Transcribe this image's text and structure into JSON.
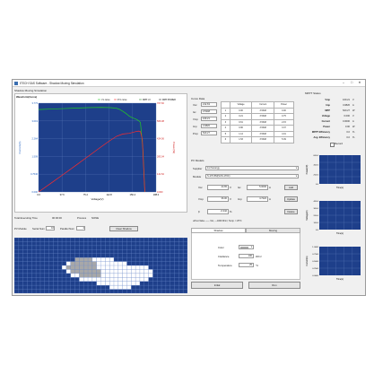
{
  "window": {
    "title": "ITECH SAS Software - Shadow Moving Simulation",
    "min": "–",
    "max": "□",
    "close": "✕"
  },
  "section_title": "Shadow Moving Simulation",
  "chart_data": {
    "type": "line",
    "title": "Waveform(Curve)",
    "xlabel": "Voltage(V)",
    "ylabel_left": "Current(A)",
    "ylabel_right": "Power(W)",
    "legend": [
      "I-V curve",
      "P-V curve",
      "MPP I-V",
      "MPP POWER"
    ],
    "legend_placement": "top-right",
    "grid": true,
    "xlim": [
      0,
      188
    ],
    "ylim_left": [
      0,
      3.77
    ],
    "ylim_right": [
      0,
      707.6
    ],
    "x_ticks": [
      "0.0",
      "37.6",
      "75.2",
      "112.8",
      "150.4",
      "188.0"
    ],
    "y_left_ticks": [
      "0.000",
      "0.7546",
      "1.509",
      "2.264",
      "3.019",
      "3.773"
    ],
    "y_right_ticks": [
      "0.000",
      "141.52",
      "283.04",
      "424.56",
      "566.08",
      "707.60"
    ],
    "series": [
      {
        "name": "I-V curve",
        "color": "#22cc22",
        "x": [
          0,
          20,
          40,
          60,
          80,
          100,
          115,
          125,
          130,
          135,
          140,
          145,
          150,
          155,
          160,
          163,
          167,
          170
        ],
        "y": [
          3.5,
          3.52,
          3.54,
          3.56,
          3.58,
          3.59,
          3.58,
          3.55,
          3.5,
          3.42,
          3.33,
          3.22,
          3.15,
          3.1,
          3.03,
          2.95,
          1.8,
          0
        ]
      },
      {
        "name": "P-V curve",
        "color": "#ff2a2a",
        "x": [
          0,
          20,
          40,
          60,
          80,
          100,
          115,
          125,
          135,
          145,
          155,
          160,
          163,
          166,
          170
        ],
        "y": [
          0,
          70,
          141,
          213,
          286,
          359,
          412,
          444,
          462,
          467,
          480,
          485,
          481,
          420,
          0
        ]
      }
    ]
  },
  "bottom_left": {
    "total_label": "Total Executing Time",
    "total_value": "00:00:00",
    "process_label": "Process",
    "process_value": "NONE",
    "pv_label": "PV Module",
    "serial_label": "Serial Num",
    "serial_value": "10",
    "parallel_label": "Parallel Num",
    "parallel_value": "4",
    "clear_btn": "Clear Shadow"
  },
  "curve_data": {
    "title": "Curve Data",
    "fields": [
      {
        "label": "Voc",
        "value": "212.63"
      },
      {
        "label": "Isc",
        "value": "3.5348"
      },
      {
        "label": "Vmp",
        "value": "169.21"
      },
      {
        "label": "Imp",
        "value": "3.0826"
      },
      {
        "label": "Pmp",
        "value": "520.27"
      }
    ],
    "columns": [
      "",
      "Voltage",
      "Current",
      "Power"
    ],
    "rows": [
      [
        "1",
        "0.00",
        "3.5348",
        "0.00"
      ],
      [
        "2",
        "0.21",
        "3.5348",
        "0.75"
      ],
      [
        "3",
        "0.61",
        "3.5348",
        "2.15"
      ],
      [
        "4",
        "0.96",
        "3.5348",
        "3.37"
      ],
      [
        "5",
        "1.14",
        "3.5348",
        "4.01"
      ],
      [
        "6",
        "1.53",
        "3.5348",
        "5.39"
      ]
    ]
  },
  "pv_models": {
    "title": "PV Models",
    "supplier_label": "Supplier",
    "supplier_value": "1st Sunergy",
    "module_label": "Module",
    "module_value": "S-170-5M(SUS-170C)",
    "voc_label": "Voc",
    "voc_value": "44.65",
    "voc_unit": "V",
    "isc_label": "Isc",
    "isc_value": "5.0000",
    "isc_unit": "A",
    "vmp_label": "Vmp",
    "vmp_value": "36.00",
    "vmp_unit": "V",
    "imp_label": "Imp",
    "imp_value": "4.7222",
    "imp_unit": "A",
    "ff_label": "β",
    "ff_value": "-0.342",
    "ff_unit": "%",
    "add_btn": "Add",
    "update_btn": "Update",
    "delete_btn": "Delete",
    "test_note": "★Test Value —— Voc, —1000 W/m², Temp. = 25°C"
  },
  "tabs": [
    "Shadow",
    "Moving"
  ],
  "shadow": {
    "color_label": "Color",
    "irradiance_label": "Irradiance",
    "irradiance_value": "100",
    "irradiance_unit": "W/m²",
    "temperature_label": "Temperature",
    "temperature_value": "25",
    "temperature_unit": "°C"
  },
  "actions": {
    "initial": "Initial",
    "run": "Run"
  },
  "mppt": {
    "title": "MPPT Status",
    "rows": [
      {
        "label": "Vmp",
        "value": "169.21",
        "unit": "V"
      },
      {
        "label": "Imp",
        "value": "3.0826",
        "unit": "A"
      },
      {
        "label": "MPP",
        "value": "520.27",
        "unit": "W"
      },
      {
        "label": "Voltage",
        "value": "0.000",
        "unit": "V"
      },
      {
        "label": "Current",
        "value": "0.0000",
        "unit": "A"
      },
      {
        "label": "Power",
        "value": "0.00",
        "unit": "W"
      },
      {
        "label": "MPPT Efficiency",
        "value": "0.0",
        "unit": "%"
      },
      {
        "label": "Avg. Efficiency",
        "value": "0.0",
        "unit": "%"
      }
    ],
    "record_label": "Record"
  },
  "mini_charts": [
    {
      "ylabel": "Power(W)",
      "xlabel": "Time(s)",
      "ticks": [
        "600.0",
        "400.0",
        "200.0",
        "0.0"
      ]
    },
    {
      "ylabel": "Voltage(V)",
      "xlabel": "Time(s)",
      "ticks": [
        "400.0",
        "300.0",
        "200.0",
        "100.0",
        "0.0"
      ]
    },
    {
      "ylabel": "Current(A)",
      "xlabel": "Time(s)",
      "ticks": [
        "1.0000",
        "0.7500",
        "0.5000",
        "0.2500",
        "0.0000"
      ]
    }
  ],
  "colors": {
    "grid_bg": "#1e3f8a",
    "shadow_light": "#ffffff",
    "shadow_dark": "#a8a8a8",
    "iv": "#22cc22",
    "pv": "#ff2a2a"
  }
}
